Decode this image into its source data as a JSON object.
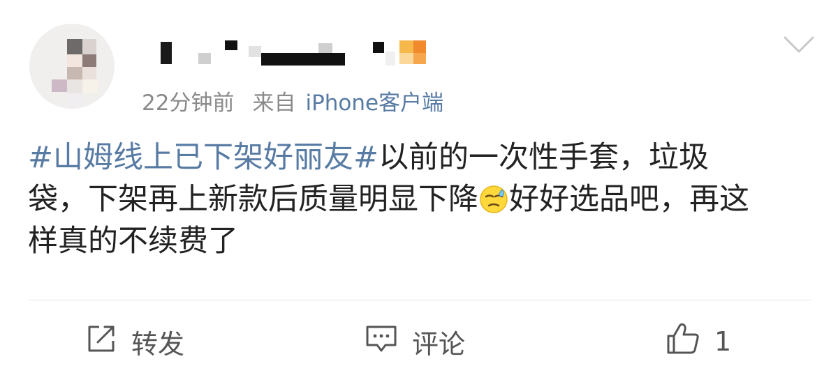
{
  "post": {
    "author_name": "",
    "time": "22分钟前",
    "source_prefix": "来自",
    "source_client": "iPhone客户端",
    "hashtag": "#山姆线上已下架好丽友#",
    "text_line1": "以前的一次性手套，垃圾",
    "text_line2": "袋，下架再上新款后质量明显下降",
    "emoji_name": "sweat-face-emoji",
    "text_line2_after": "好好选品吧，再这",
    "text_line3": "样真的不续费了"
  },
  "actions": {
    "repost_label": "转发",
    "comment_label": "评论",
    "like_count": "1"
  },
  "colors": {
    "link": "#587ba4",
    "meta": "#8a8a8a",
    "text": "#222222",
    "divider": "#e6e6e6"
  }
}
